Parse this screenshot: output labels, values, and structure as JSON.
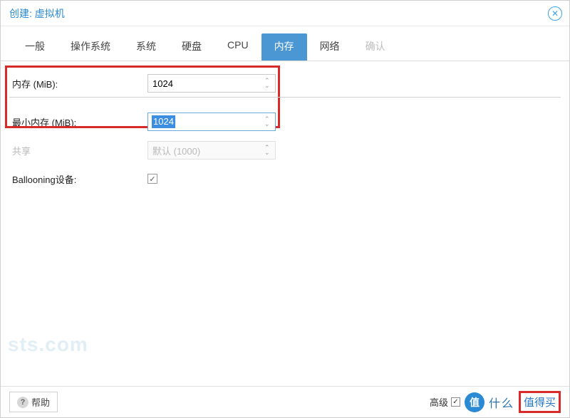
{
  "title": "创建: 虚拟机",
  "tabs": [
    {
      "label": "一般"
    },
    {
      "label": "操作系统"
    },
    {
      "label": "系统"
    },
    {
      "label": "硬盘"
    },
    {
      "label": "CPU"
    },
    {
      "label": "内存",
      "active": true
    },
    {
      "label": "网络"
    },
    {
      "label": "确认",
      "disabled": true
    }
  ],
  "fields": {
    "memory_label": "内存 (MiB):",
    "memory_value": "1024",
    "min_memory_label": "最小内存 (MiB):",
    "min_memory_value": "1024",
    "shared_label": "共享",
    "shared_value": "默认 (1000)",
    "ballooning_label": "Ballooning设备:",
    "ballooning_checked": "✓"
  },
  "footer": {
    "help": "帮助",
    "advanced": "高级",
    "advanced_checked": "✓",
    "badge": "值",
    "overlay1": "什么",
    "overlay2": "值得买"
  },
  "watermark": "sts.com"
}
